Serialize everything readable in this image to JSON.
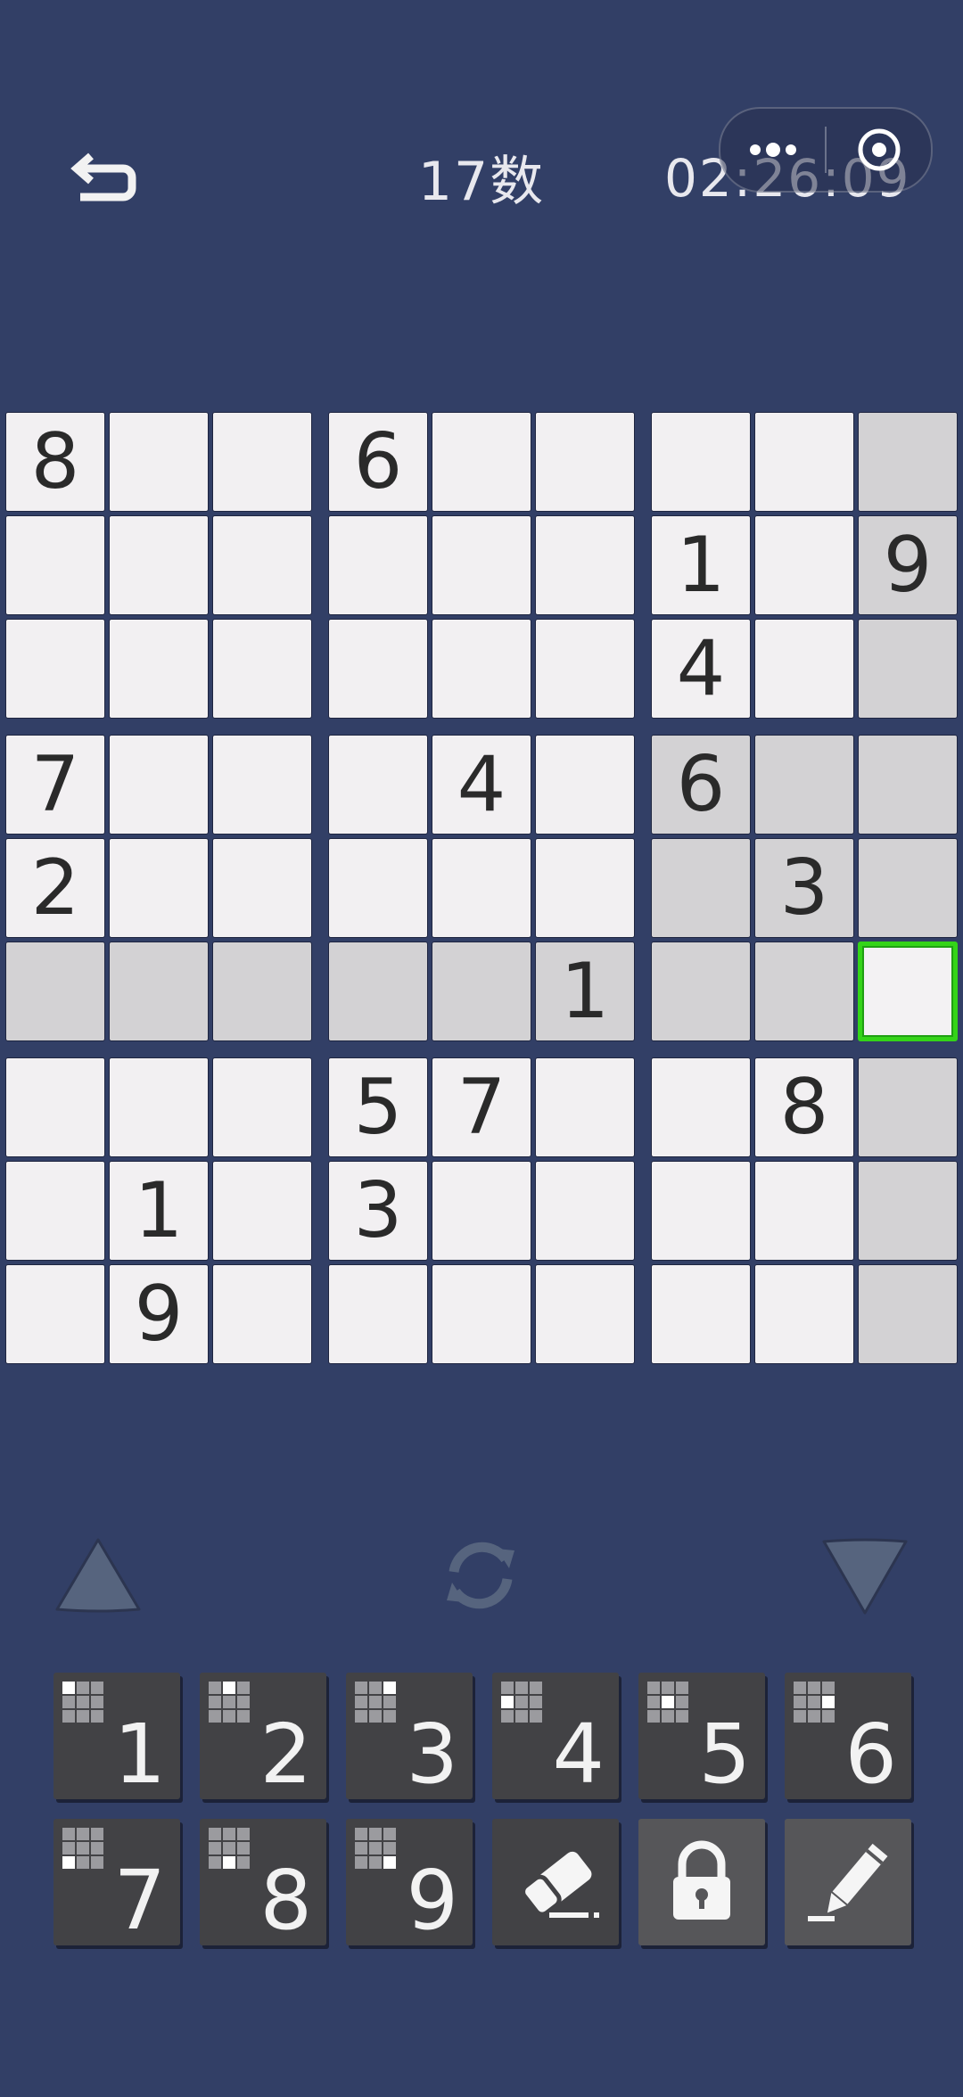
{
  "header": {
    "title": "17数",
    "timer": "02:26:09"
  },
  "board": {
    "cells": [
      [
        "8",
        "",
        "",
        "6",
        "",
        "",
        "",
        "",
        ""
      ],
      [
        "",
        "",
        "",
        "",
        "",
        "",
        "1",
        "",
        "9"
      ],
      [
        "",
        "",
        "",
        "",
        "",
        "",
        "4",
        "",
        ""
      ],
      [
        "7",
        "",
        "",
        "",
        "4",
        "",
        "6",
        "",
        ""
      ],
      [
        "2",
        "",
        "",
        "",
        "",
        "",
        "",
        "3",
        ""
      ],
      [
        "",
        "",
        "",
        "",
        "",
        "1",
        "",
        "",
        ""
      ],
      [
        "",
        "",
        "",
        "5",
        "7",
        "",
        "",
        "8",
        ""
      ],
      [
        "",
        "1",
        "",
        "3",
        "",
        "",
        "",
        "",
        ""
      ],
      [
        "",
        "9",
        "",
        "",
        "",
        "",
        "",
        "",
        ""
      ]
    ],
    "selected": {
      "row": 5,
      "col": 8
    }
  },
  "keypad": {
    "digits": [
      "1",
      "2",
      "3",
      "4",
      "5",
      "6",
      "7",
      "8",
      "9"
    ]
  },
  "icons": {
    "back": "undo-arrow-icon",
    "more": "more-dots-icon",
    "close": "target-icon",
    "up": "triangle-up-icon",
    "refresh": "refresh-icon",
    "down": "triangle-down-icon",
    "eraser": "eraser-icon",
    "lock": "lock-icon",
    "pencil": "pencil-icon"
  },
  "colors": {
    "background": "#323f66",
    "cell": "#f2f0f2",
    "highlight": "#d3d2d4",
    "selection": "#34d418",
    "key": "#424245"
  }
}
